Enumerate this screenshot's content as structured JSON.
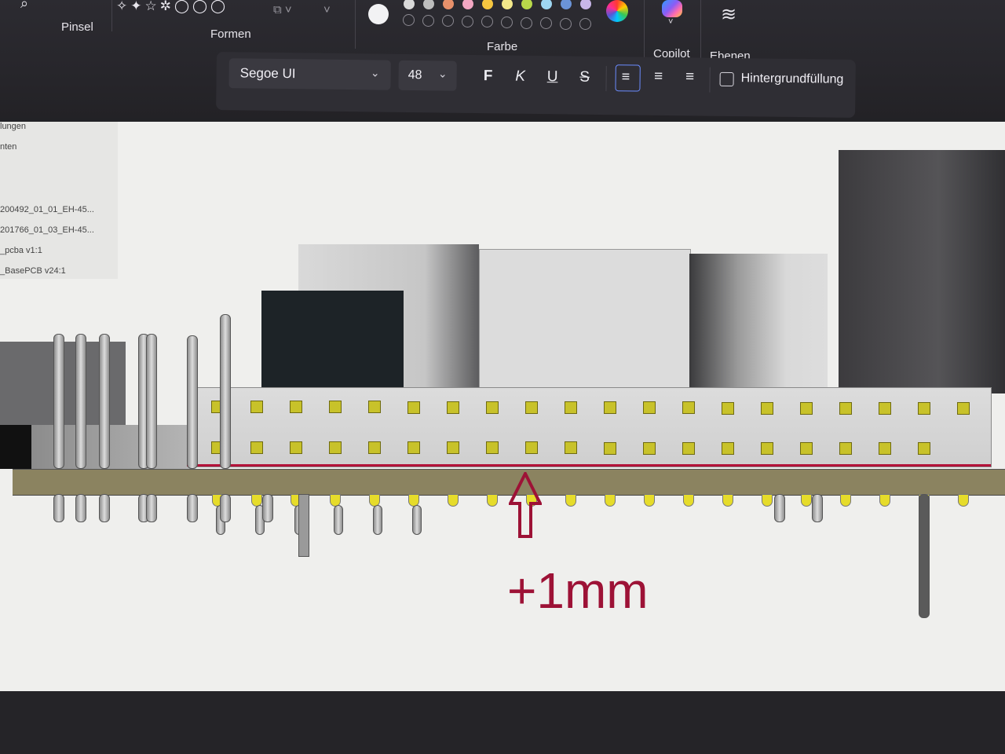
{
  "ribbon": {
    "labels": {
      "brush": "Pinsel",
      "shapes": "Formen",
      "color": "Farbe",
      "copilot": "Copilot",
      "layers": "Ebenen"
    },
    "icons": [
      "search-icon",
      "brush-icon",
      "shapes-icon",
      "crop-icon",
      "color-wheel-icon",
      "copilot-icon",
      "layers-icon"
    ]
  },
  "text_toolbar": {
    "font": "Segoe UI",
    "size": "48",
    "bold": "F",
    "italic": "K",
    "underline": "U",
    "strike": "S",
    "background_fill": "Hintergrundfüllung",
    "background_fill_checked": false
  },
  "palette": {
    "filled": [
      "#f2f2f4",
      "#d9d9d9",
      "#bdbdbd",
      "#e8906a",
      "#f2a6c2",
      "#f6c640",
      "#f3e88a",
      "#b9d84a",
      "#9ed6f2",
      "#6b94d8",
      "#c8b6e8"
    ],
    "empty_count": 10
  },
  "model_tree": {
    "items": [
      "lungen",
      "nten",
      "200492_01_01_EH-45...",
      "201766_01_03_EH-45...",
      "_pcba v1:1",
      "_BasePCB v24:1"
    ]
  },
  "annotation": {
    "text": "+1mm",
    "color": "#9d1236"
  }
}
